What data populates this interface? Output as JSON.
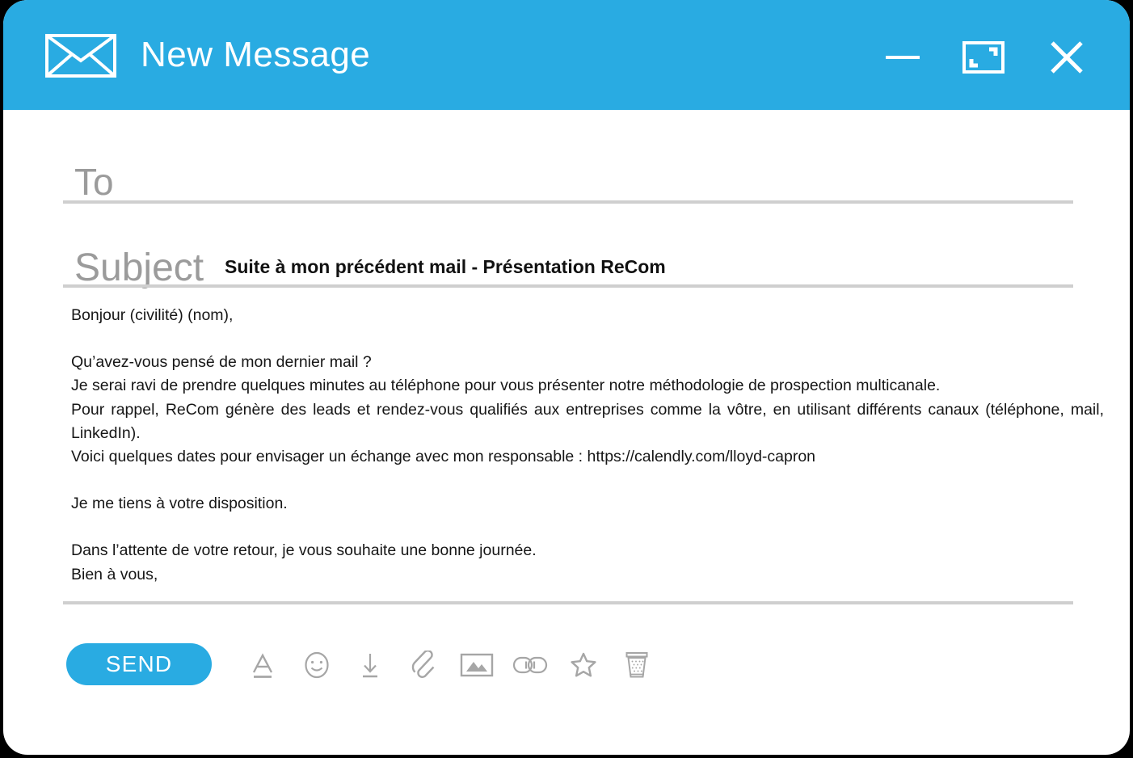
{
  "window": {
    "title": "New Message",
    "accent_color": "#29abe2",
    "icon": "envelope-icon",
    "controls": [
      {
        "name": "minimize",
        "icon": "minimize-icon"
      },
      {
        "name": "maximize",
        "icon": "maximize-icon"
      },
      {
        "name": "close",
        "icon": "close-icon"
      }
    ]
  },
  "fields": {
    "to": {
      "label": "To",
      "value": "",
      "placeholder": "To"
    },
    "subject": {
      "label": "Subject",
      "value": "Suite à mon précédent mail - Présentation ReCom",
      "placeholder": "Subject"
    }
  },
  "body": {
    "lines": [
      "Bonjour (civilité) (nom),",
      "",
      "Qu’avez-vous pensé de mon dernier mail ?",
      "Je serai ravi de prendre quelques minutes au téléphone pour vous présenter notre méthodologie de prospection multicanale.",
      "Pour rappel, ReCom génère des leads et rendez-vous qualifiés aux entreprises comme la vôtre, en utilisant différents canaux (téléphone, mail, LinkedIn).",
      "Voici quelques dates pour envisager un échange avec mon responsable : https://calendly.com/lloyd-capron",
      "",
      "Je me tiens à votre disposition.",
      "",
      "Dans l’attente de votre retour, je vous souhaite une bonne journée.",
      "Bien à vous,"
    ]
  },
  "footer": {
    "send_label": "SEND",
    "tools": [
      {
        "name": "format-text-icon",
        "label": "Formatting options"
      },
      {
        "name": "emoji-icon",
        "label": "Insert emoji"
      },
      {
        "name": "insert-from-drive-icon",
        "label": "Insert files using Drive"
      },
      {
        "name": "attachment-icon",
        "label": "Attach files"
      },
      {
        "name": "insert-photo-icon",
        "label": "Insert photo"
      },
      {
        "name": "insert-link-icon",
        "label": "Insert link"
      },
      {
        "name": "confidential-mode-icon",
        "label": "Confidential mode"
      },
      {
        "name": "discard-draft-icon",
        "label": "Discard draft"
      }
    ]
  },
  "colors": {
    "accent": "#29abe2",
    "divider": "#cfcfcf",
    "placeholder": "#9b9b9b",
    "text": "#161616",
    "icon_gray": "#a0a0a0"
  }
}
